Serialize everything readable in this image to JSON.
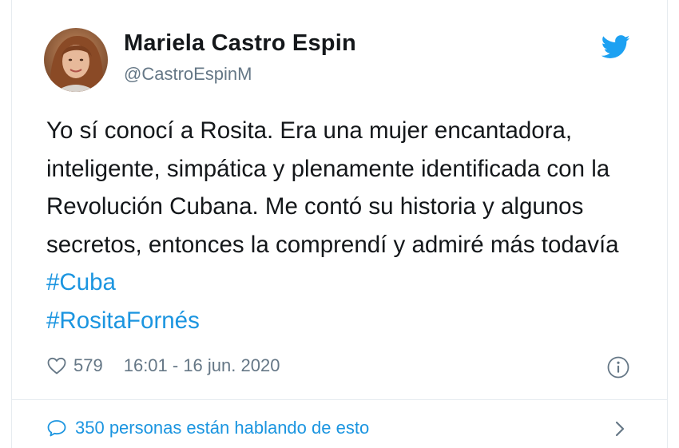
{
  "tweet": {
    "author_name": "Mariela Castro Espin",
    "author_handle": "@CastroEspinM",
    "text_main": "Yo sí conocí a Rosita. Era una mujer encantadora, inteligente, simpática y plenamente identificada con la Revolución Cubana. Me contó su historia y algunos secretos, entonces la comprendí y admiré más todavía ",
    "hashtags": [
      "#Cuba",
      "#RositaFornés"
    ],
    "likes": "579",
    "timestamp": "16:01 - 16 jun. 2020",
    "conversation": "350 personas están hablando de esto"
  },
  "icons": {
    "brand": "twitter-bird-icon",
    "like": "heart-icon",
    "info": "info-icon",
    "reply": "speech-bubble-icon",
    "more": "chevron-right-icon"
  },
  "colors": {
    "accent": "#1b95e0",
    "text": "#14171a",
    "secondary": "#657786",
    "border": "#e6ecf0"
  }
}
